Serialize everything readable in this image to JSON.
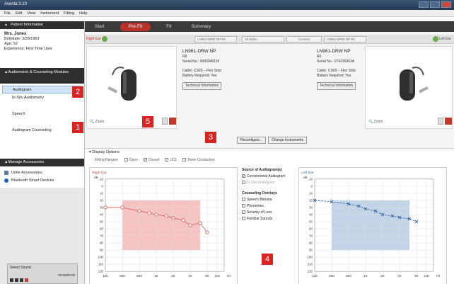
{
  "window": {
    "title": "Aventa 3.10"
  },
  "menu": [
    "File",
    "Edit",
    "View",
    "Instrument",
    "Fitting",
    "Help"
  ],
  "tabs": [
    {
      "label": "Start",
      "active": false
    },
    {
      "label": "Pre-Fit",
      "active": true
    },
    {
      "label": "Fit",
      "active": false
    },
    {
      "label": "Summary",
      "active": false
    }
  ],
  "sidebar": {
    "patient_header": "Patient Information",
    "patient": {
      "name": "Mrs. Jones",
      "birthdate": "Birthdate: 3/28/1963",
      "age": "Age: 52",
      "experience": "Experience: First Time User"
    },
    "modules_header": "Audiometric & Counseling Modules",
    "modules": [
      {
        "label": "Audiogram",
        "selected": true
      },
      {
        "label": "In-Situ Audiometry",
        "selected": false
      },
      {
        "label": "Speech",
        "selected": false
      },
      {
        "label": "Audiogram Counseling",
        "selected": false
      }
    ],
    "accessories_header": "Manage Accessories",
    "accessories": [
      {
        "label": "Unite Accessories",
        "icon": "accessory-icon"
      },
      {
        "label": "Bluetooth Smart Devices",
        "icon": "bluetooth-icon"
      }
    ],
    "sound": {
      "label": "Select Sound",
      "time": "00:00/00:00"
    }
  },
  "ear_strip": {
    "right_label": "Right Ear",
    "left_label": "Left Ear",
    "right_connection": "LN961-DRW NP R6",
    "right_side": "All Sides",
    "connect_label": "Connect",
    "left_connection": "LN961-DRW NP R6"
  },
  "devices": {
    "right": {
      "model": "LN961-DRW NP",
      "line2": "R6",
      "serial": "Serial No.: 0090048118",
      "cable": "Cable: CS03 – Flex Strip",
      "battery": "Battery Required: Yes",
      "tech_btn": "Technical Information",
      "zoom": "Zoom"
    },
    "left": {
      "model": "LN961-DRW NP",
      "line2": "R6",
      "serial": "Serial No.: 074235963A",
      "cable": "Cable: CS03 – Flex Strip",
      "battery": "Battery Required: Yes",
      "tech_btn": "Technical Information",
      "zoom": "Zoom"
    }
  },
  "actions": {
    "reconfigure": "Reconfigure...",
    "change": "Change Instruments"
  },
  "display_options": {
    "title": "Display Options",
    "fitting_ranges_label": "Fitting Ranges:",
    "options": [
      {
        "label": "Open",
        "checked": false
      },
      {
        "label": "Closed",
        "checked": true
      },
      {
        "label": "UCL",
        "checked": false
      },
      {
        "label": "Bone Conduction",
        "checked": false
      }
    ]
  },
  "source": {
    "title": "Source of Audiogram(s)",
    "items": [
      {
        "label": "Conventional Audiogram",
        "checked": true,
        "dim": false
      },
      {
        "label": "In-Situ Audiogram",
        "checked": false,
        "dim": true
      }
    ],
    "overlays_title": "Counseling Overlays",
    "overlays": [
      "Speech Banana",
      "Phonemes",
      "Severity of Loss",
      "Familiar Sounds"
    ]
  },
  "callouts": [
    "1",
    "2",
    "3",
    "4",
    "5"
  ],
  "chart_data": [
    {
      "type": "line",
      "title": "Right Ear",
      "ylabel": "dB",
      "x": [
        "125",
        "250",
        "500",
        "1K",
        "2K",
        "4K",
        "8K",
        "12K",
        "Hz"
      ],
      "y_ticks": [
        "-10",
        "0",
        "10",
        "20",
        "30",
        "40",
        "50",
        "60",
        "70",
        "80",
        "90",
        "100",
        "110",
        "120"
      ],
      "ylim": [
        -10,
        120
      ],
      "series": [
        {
          "values_x_hz": [
            125,
            250,
            500,
            750,
            1000,
            1500,
            2000,
            3000,
            4000,
            6000,
            8000
          ],
          "values": [
            30,
            30,
            35,
            38,
            40,
            42,
            45,
            48,
            55,
            52,
            65
          ]
        }
      ],
      "colors": {
        "line": "#d9534f",
        "band": "#f2a9a9"
      }
    },
    {
      "type": "line",
      "title": "Left Ear",
      "ylabel": "dB",
      "x": [
        "125",
        "250",
        "500",
        "1K",
        "2K",
        "4K",
        "8K",
        "12K",
        "Hz"
      ],
      "y_ticks": [
        "-10",
        "0",
        "10",
        "20",
        "30",
        "40",
        "50",
        "60",
        "70",
        "80",
        "90",
        "100",
        "110",
        "120"
      ],
      "ylim": [
        -10,
        120
      ],
      "series": [
        {
          "values_x_hz": [
            125,
            250,
            500,
            750,
            1000,
            1500,
            2000,
            3000,
            4000,
            6000,
            8000
          ],
          "values": [
            20,
            22,
            25,
            28,
            32,
            35,
            40,
            42,
            44,
            46,
            50
          ]
        }
      ],
      "colors": {
        "line": "#2e5d9e",
        "band": "#a9c2e0"
      }
    }
  ]
}
